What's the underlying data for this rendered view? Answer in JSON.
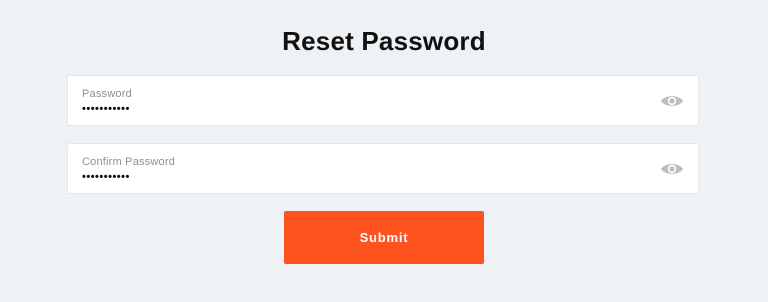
{
  "page": {
    "title": "Reset Password"
  },
  "form": {
    "password": {
      "label": "Password",
      "value": "•••••••••••"
    },
    "confirm_password": {
      "label": "Confirm Password",
      "value": "•••••••••••"
    },
    "submit_label": "Submit"
  },
  "icons": {
    "show_password": "eye-icon"
  },
  "colors": {
    "background": "#eff2f5",
    "accent": "#ff531f",
    "field_bg": "#ffffff",
    "label": "#8a8f96",
    "icon": "#b9bec4"
  }
}
